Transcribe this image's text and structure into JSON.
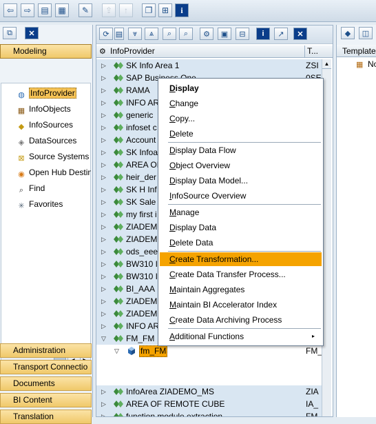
{
  "top_toolbar": {
    "buttons": [
      {
        "icon": "back-arrow-icon",
        "glyph": "⇦"
      },
      {
        "icon": "forward-arrow-icon",
        "glyph": "⇨"
      },
      {
        "icon": "table-view-icon",
        "glyph": "▤"
      },
      {
        "icon": "tree-view-icon",
        "glyph": "▦"
      },
      {
        "icon": "pencil-icon",
        "glyph": "✎"
      },
      {
        "icon": "transport-icon",
        "glyph": "⇪"
      },
      {
        "icon": "up-arrow-icon",
        "glyph": "↑"
      },
      {
        "icon": "copy-window-icon",
        "glyph": "❐"
      },
      {
        "icon": "hierarchy-icon",
        "glyph": "⊞"
      },
      {
        "icon": "info-icon",
        "glyph": "i"
      }
    ]
  },
  "left_panel": {
    "headers": {
      "modeling": "Modeling",
      "administration": "Administration",
      "transport": "Transport Connectio",
      "documents": "Documents",
      "bi_content": "BI Content",
      "translation": "Translation"
    },
    "nav_items": [
      {
        "label": "InfoProvider",
        "icon": "infoprovider-icon",
        "glyph": "◍",
        "color": "#2b6bb3"
      },
      {
        "label": "InfoObjects",
        "icon": "infoobjects-icon",
        "glyph": "▦",
        "color": "#8a5a16"
      },
      {
        "label": "InfoSources",
        "icon": "infosources-icon",
        "glyph": "◆",
        "color": "#c49a12"
      },
      {
        "label": "DataSources",
        "icon": "datasources-icon",
        "glyph": "◈",
        "color": "#777777"
      },
      {
        "label": "Source Systems",
        "icon": "source-systems-icon",
        "glyph": "⊠",
        "color": "#c49a12"
      },
      {
        "label": "Open Hub Destin",
        "icon": "open-hub-icon",
        "glyph": "◉",
        "color": "#d87a16"
      },
      {
        "label": "Find",
        "icon": "binoculars-icon",
        "glyph": "⌕",
        "color": "#333333"
      },
      {
        "label": "Favorites",
        "icon": "favorites-icon",
        "glyph": "✳",
        "color": "#556677"
      }
    ]
  },
  "tree": {
    "header": {
      "object": "InfoProvider",
      "tech": "T..."
    },
    "rows": [
      {
        "text": "SK Info Area 1",
        "tech": "ZSI"
      },
      {
        "text": "SAP Business One",
        "tech": "0SE"
      },
      {
        "text": "RAMA",
        "tech": ""
      },
      {
        "text": "INFO AR",
        "tech": ""
      },
      {
        "text": "generic",
        "tech": ""
      },
      {
        "text": "infoset c",
        "tech": ""
      },
      {
        "text": "Account",
        "tech": ""
      },
      {
        "text": "SK Infoa",
        "tech": ""
      },
      {
        "text": "AREA OI",
        "tech": ""
      },
      {
        "text": "heir_der",
        "tech": ""
      },
      {
        "text": "SK H Inf",
        "tech": ""
      },
      {
        "text": "SK Sale",
        "tech": ""
      },
      {
        "text": "my first i",
        "tech": ""
      },
      {
        "text": "ZIADEMO",
        "tech": ""
      },
      {
        "text": "ZIADEMO",
        "tech": ""
      },
      {
        "text": "ods_eee",
        "tech": ""
      },
      {
        "text": "BW310 I",
        "tech": ""
      },
      {
        "text": "BW310 I",
        "tech": ""
      },
      {
        "text": "BI_AAA",
        "tech": ""
      },
      {
        "text": "ZIADEMO",
        "tech": ""
      },
      {
        "text": "ZIADEMO",
        "tech": ""
      },
      {
        "text": "INFO AR",
        "tech": ""
      },
      {
        "text": "FM_FM",
        "tech": ""
      },
      {
        "text": "fm_FM",
        "tech": "FM_"
      },
      {
        "text": "InfoArea ZIADEMO_MS",
        "tech": "ZIA"
      },
      {
        "text": "AREA OF REMOTE CUBE",
        "tech": "IA_"
      },
      {
        "text": "function module extraction",
        "tech": "FM"
      }
    ]
  },
  "right_panel": {
    "template_header": "Template",
    "item": "No"
  },
  "context_menu": {
    "items": [
      {
        "key": "display",
        "label": "Display",
        "accel": "D",
        "rest": "isplay",
        "bold": true
      },
      {
        "key": "change",
        "label": "Change",
        "accel": "C",
        "rest": "hange"
      },
      {
        "key": "copy",
        "label": "Copy...",
        "accel": "C",
        "rest": "opy..."
      },
      {
        "key": "delete",
        "label": "Delete",
        "accel": "D",
        "rest": "elete"
      },
      {
        "key": "display_data_flow",
        "label": "Display Data Flow",
        "accel": "D",
        "rest": "isplay Data Flow"
      },
      {
        "key": "object_overview",
        "label": "Object Overview",
        "accel": "O",
        "rest": "bject Overview"
      },
      {
        "key": "display_data_model",
        "label": "Display Data Model...",
        "accel": "D",
        "rest": "isplay Data Model..."
      },
      {
        "key": "infosource_overview",
        "label": "InfoSource Overview",
        "accel": "I",
        "rest": "nfoSource Overview"
      },
      {
        "key": "manage",
        "label": "Manage",
        "accel": "M",
        "rest": "anage"
      },
      {
        "key": "display_data",
        "label": "Display Data",
        "accel": "D",
        "rest": "isplay Data"
      },
      {
        "key": "delete_data",
        "label": "Delete Data",
        "accel": "D",
        "rest": "elete Data"
      },
      {
        "key": "create_transformation",
        "label": "Create Transformation...",
        "accel": "C",
        "rest": "reate Transformation..."
      },
      {
        "key": "create_dtp",
        "label": "Create Data Transfer Process...",
        "accel": "C",
        "rest": "reate Data Transfer Process..."
      },
      {
        "key": "maintain_aggregates",
        "label": "Maintain Aggregates",
        "accel": "M",
        "rest": "aintain Aggregates"
      },
      {
        "key": "maintain_bia_index",
        "label": "Maintain BI Accelerator Index",
        "accel": "M",
        "rest": "aintain BI Accelerator Index"
      },
      {
        "key": "create_archiving",
        "label": "Create Data Archiving Process",
        "accel": "C",
        "rest": "reate Data Archiving Process"
      },
      {
        "key": "additional_functions",
        "label": "Additional Functions",
        "accel": "A",
        "rest": "dditional Functions",
        "submenu": true
      }
    ]
  },
  "colors": {
    "highlight": "#f5a300",
    "nav_header": "#f0c96a",
    "tree_shade": "#d9e6f2",
    "infoarea_icon": "#3c8a3c",
    "cube_icon": "#2b6bb3"
  }
}
